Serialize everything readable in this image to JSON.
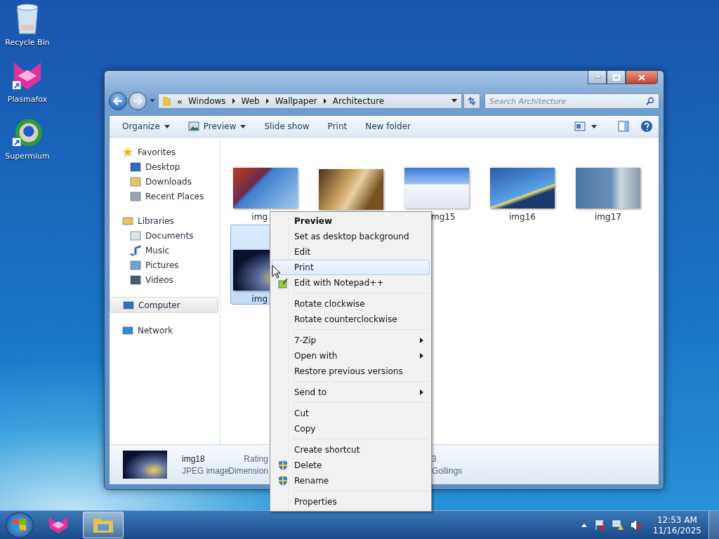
{
  "desktop_icons": [
    {
      "label": "Recycle Bin",
      "kind": "recycle"
    },
    {
      "label": "Plasmafox",
      "kind": "fox"
    },
    {
      "label": "Supermium",
      "kind": "globe"
    }
  ],
  "window": {
    "address": {
      "overflow_marker": "«",
      "crumbs": [
        "Windows",
        "Web",
        "Wallpaper",
        "Architecture"
      ]
    },
    "search": {
      "placeholder": "Search Architecture"
    },
    "toolbar": [
      {
        "label": "Organize",
        "kind": "dropdown"
      },
      {
        "label": "Preview",
        "kind": "preview"
      },
      {
        "label": "Slide show",
        "kind": "plain"
      },
      {
        "label": "Print",
        "kind": "plain"
      },
      {
        "label": "New folder",
        "kind": "plain"
      }
    ],
    "nav": [
      {
        "label": "Favorites",
        "kind": "star",
        "selected": false,
        "children": [
          {
            "label": "Desktop",
            "kind": "desktop",
            "selected": false
          },
          {
            "label": "Downloads",
            "kind": "downloads",
            "selected": false
          },
          {
            "label": "Recent Places",
            "kind": "recent",
            "selected": false
          }
        ]
      },
      {
        "label": "Libraries",
        "kind": "libraries",
        "selected": false,
        "children": [
          {
            "label": "Documents",
            "kind": "documents",
            "selected": false
          },
          {
            "label": "Music",
            "kind": "music",
            "selected": false
          },
          {
            "label": "Pictures",
            "kind": "pictures",
            "selected": false
          },
          {
            "label": "Videos",
            "kind": "videos",
            "selected": false
          }
        ]
      },
      {
        "label": "Computer",
        "kind": "computer",
        "selected": true
      },
      {
        "label": "Network",
        "kind": "network",
        "selected": false
      }
    ],
    "files": [
      {
        "label": "img",
        "selected": false
      },
      {
        "selected": false
      },
      {
        "label": "mg15",
        "selected": false
      },
      {
        "label": "img16",
        "selected": false
      },
      {
        "label": "img17",
        "selected": false
      },
      {
        "label": "img",
        "selected": true
      }
    ],
    "details": {
      "name": "img18",
      "type": "JPEG image",
      "labels": [
        "Rating",
        "Dimension"
      ],
      "values": [
        "3",
        "Gollings"
      ]
    }
  },
  "context_menu": [
    {
      "kind": "command",
      "label": "Preview",
      "default": true,
      "selected": false
    },
    {
      "kind": "command",
      "label": "Set as desktop background",
      "default": false,
      "selected": false
    },
    {
      "kind": "command",
      "label": "Edit",
      "default": false,
      "selected": false
    },
    {
      "kind": "command",
      "label": "Print",
      "default": false,
      "selected": true
    },
    {
      "kind": "plugin",
      "label": "Edit with Notepad++",
      "default": false,
      "selected": false
    },
    {
      "kind": "separator"
    },
    {
      "kind": "command",
      "label": "Rotate clockwise",
      "default": false,
      "selected": false
    },
    {
      "kind": "command",
      "label": "Rotate counterclockwise",
      "default": false,
      "selected": false
    },
    {
      "kind": "separator"
    },
    {
      "kind": "submenu",
      "label": "7-Zip",
      "default": false,
      "selected": false
    },
    {
      "kind": "submenu",
      "label": "Open with",
      "default": false,
      "selected": false
    },
    {
      "kind": "command",
      "label": "Restore previous versions",
      "default": false,
      "selected": false
    },
    {
      "kind": "separator"
    },
    {
      "kind": "submenu",
      "label": "Send to",
      "default": false,
      "selected": false
    },
    {
      "kind": "separator"
    },
    {
      "kind": "command",
      "label": "Cut",
      "default": false,
      "selected": false
    },
    {
      "kind": "command",
      "label": "Copy",
      "default": false,
      "selected": false
    },
    {
      "kind": "separator"
    },
    {
      "kind": "command",
      "label": "Create shortcut",
      "default": false,
      "selected": false
    },
    {
      "kind": "shield",
      "label": "Delete",
      "default": false,
      "selected": false
    },
    {
      "kind": "shield",
      "label": "Rename",
      "default": false,
      "selected": false
    },
    {
      "kind": "separator"
    },
    {
      "kind": "command",
      "label": "Properties",
      "default": false,
      "selected": false
    }
  ],
  "taskbar": {
    "apps": [
      {
        "kind": "fox",
        "selected": false
      },
      {
        "kind": "explorer",
        "selected": true
      }
    ],
    "time": "12:53 AM",
    "date": "11/16/2025"
  }
}
